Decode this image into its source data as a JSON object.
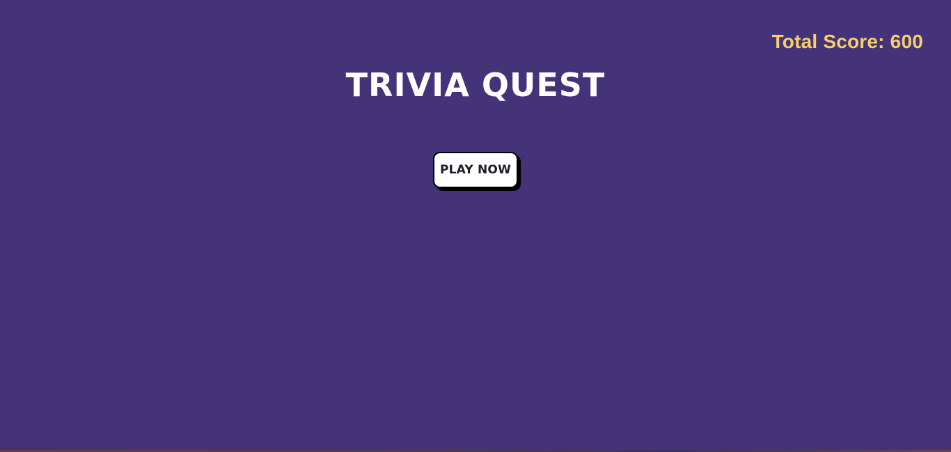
{
  "header": {
    "score_text": "Total Score: 600"
  },
  "main": {
    "title": "TRIVIA QUEST",
    "play_button_label": "PLAY NOW"
  },
  "colors": {
    "background": "#45337a",
    "score": "#f6d06b",
    "title": "#ffffff",
    "button_bg": "#ffffff",
    "button_text": "#1c1c2a"
  }
}
